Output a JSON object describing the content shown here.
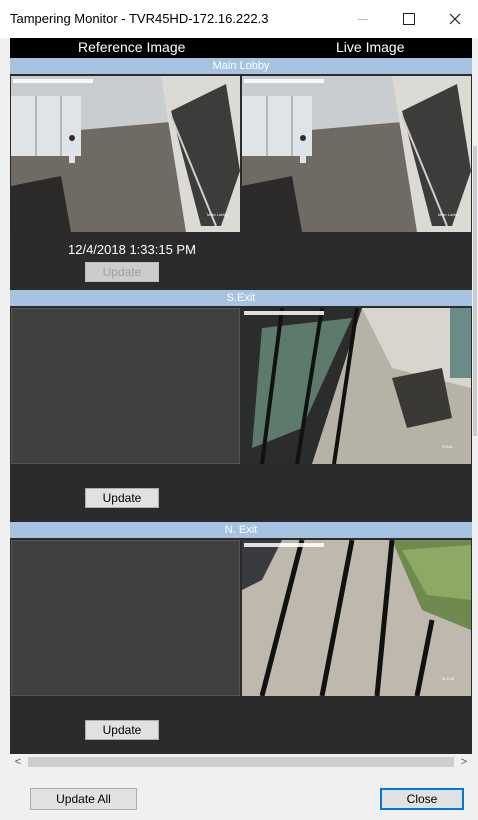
{
  "window": {
    "title": "Tampering Monitor - TVR45HD-172.16.222.3"
  },
  "header": {
    "reference_label": "Reference Image",
    "live_label": "Live Image"
  },
  "cameras": [
    {
      "name": "Main Lobby",
      "timestamp": "12/4/2018 1:33:15 PM",
      "update_label": "Update",
      "update_enabled": false,
      "reference_available": true,
      "overlay_label": "Main Lobby"
    },
    {
      "name": "S.Exit",
      "timestamp": "",
      "update_label": "Update",
      "update_enabled": true,
      "reference_available": false,
      "overlay_label": "S.Exit"
    },
    {
      "name": "N. Exit",
      "timestamp": "",
      "update_label": "Update",
      "update_enabled": true,
      "reference_available": false,
      "overlay_label": "N. Exit"
    }
  ],
  "footer": {
    "update_all_label": "Update All",
    "close_label": "Close"
  },
  "icons": {
    "minimize": "minimize-icon",
    "maximize": "maximize-icon",
    "close": "close-icon",
    "scroll_left": "chevron-left-icon",
    "scroll_right": "chevron-right-icon"
  },
  "colors": {
    "camera_bar": "#a6c4e2",
    "panel_bg": "#2b2b2b",
    "header_bg": "#000000",
    "close_border": "#0078d7"
  }
}
